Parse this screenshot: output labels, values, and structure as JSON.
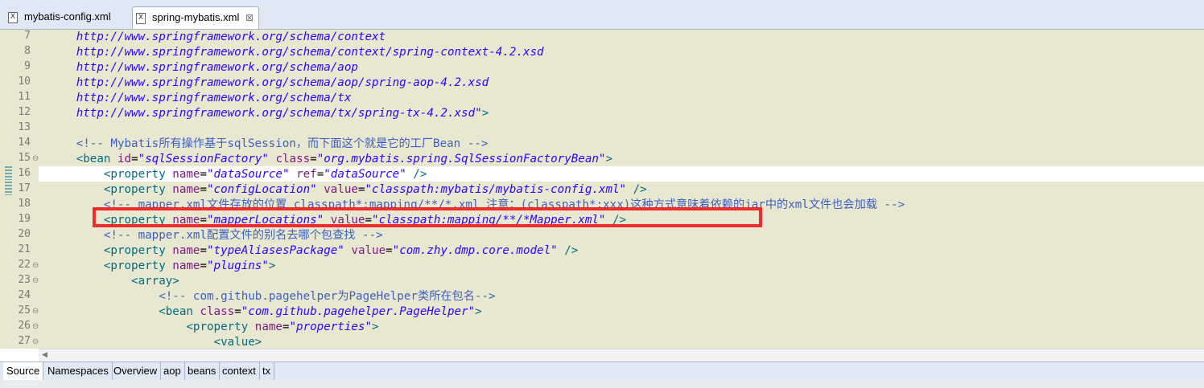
{
  "tabs": [
    {
      "label": "mybatis-config.xml",
      "icon": "xml-file-icon",
      "active": false
    },
    {
      "label": "spring-mybatis.xml",
      "icon": "xml-file-icon",
      "active": true,
      "close": "⊠"
    }
  ],
  "editor": {
    "line_numbers": [
      "7",
      "8",
      "9",
      "10",
      "11",
      "12",
      "13",
      "14",
      "15",
      "16",
      "17",
      "18",
      "19",
      "20",
      "21",
      "22",
      "23",
      "24",
      "25",
      "26",
      "27"
    ],
    "fold_marker": "⊖",
    "lines": {
      "l7": "http://www.springframework.org/schema/context",
      "l8": "http://www.springframework.org/schema/context/spring-context-4.2.xsd",
      "l9": "http://www.springframework.org/schema/aop",
      "l10": "http://www.springframework.org/schema/aop/spring-aop-4.2.xsd",
      "l11": "http://www.springframework.org/schema/tx",
      "l12_url": "http://www.springframework.org/schema/tx/spring-tx-4.2.xsd\"",
      "l12_end": ">",
      "l14_open": "<!-- Mybatis",
      "l14_cjk1": "所有操作基于",
      "l14_mid": "sqlSession",
      "l14_cjk2": "，而下面这个就是它的工厂",
      "l14_end": "Bean -->",
      "l15_tag": "<bean ",
      "l15_id": "id",
      "l15_eq1": "=",
      "l15_idv": "\"sqlSessionFactory\"",
      "l15_class": "class",
      "l15_eq2": "=",
      "l15_classv": "\"org.mybatis.spring.SqlSessionFactoryBean\"",
      "l15_end": ">",
      "l16_tag": "<property ",
      "l16_name": "name",
      "l16_eq1": "=",
      "l16_namev": "\"dataSource\"",
      "l16_ref": "ref",
      "l16_eq2": "=",
      "l16_refv": "\"dataSource\"",
      "l16_end": " />",
      "l17_tag": "<property ",
      "l17_name": "name",
      "l17_eq1": "=",
      "l17_namev": "\"configLocation\"",
      "l17_value": "value",
      "l17_eq2": "=",
      "l17_valuev": "\"classpath:mybatis/mybatis-config.xml\"",
      "l17_end": " />",
      "l18_open": "<!-- mapper.xml",
      "l18_cjk1": "文件存放的位置",
      "l18_mid": " classpath*:mapping/**/*.xml ",
      "l18_cjk2": "注意：",
      "l18_mid2": "(classpath*:xxx)",
      "l18_cjk3": "这种方式意味着依赖的",
      "l18_jar": "jar",
      "l18_cjk4": "中的",
      "l18_xml": "xml",
      "l18_cjk5": "文件也会加载",
      "l18_end": " -->",
      "l19_tag": "<property ",
      "l19_name": "name",
      "l19_eq1": "=",
      "l19_namev": "\"mapperLocations\"",
      "l19_value": "value",
      "l19_eq2": "=",
      "l19_valuev": "\"classpath:mapping/**/*Mapper.xml\"",
      "l19_end": " />",
      "l20_open": "<!-- mapper.xml",
      "l20_cjk": "配置文件的别名去哪个包查找",
      "l20_end": " -->",
      "l21_tag": "<property ",
      "l21_name": "name",
      "l21_eq1": "=",
      "l21_namev": "\"typeAliasesPackage\"",
      "l21_value": "value",
      "l21_eq2": "=",
      "l21_valuev": "\"com.zhy.dmp.core.model\"",
      "l21_end": " />",
      "l22_tag": "<property ",
      "l22_name": "name",
      "l22_eq1": "=",
      "l22_namev": "\"plugins\"",
      "l22_end": ">",
      "l23": "<array>",
      "l24_open": "<!-- com.github.pagehelper",
      "l24_cjk1": "为",
      "l24_mid": "PageHelper",
      "l24_cjk2": "类所在包名",
      "l24_end": "-->",
      "l25_tag": "<bean ",
      "l25_class": "class",
      "l25_eq": "=",
      "l25_classv": "\"com.github.pagehelper.PageHelper\"",
      "l25_end": ">",
      "l26_tag": "<property ",
      "l26_name": "name",
      "l26_eq": "=",
      "l26_namev": "\"properties\"",
      "l26_end": ">",
      "l27": "<value>"
    }
  },
  "bottom_tabs": [
    "Source",
    "Namespaces",
    "Overview",
    "aop",
    "beans",
    "context",
    "tx"
  ],
  "colors": {
    "tag": "#006c84",
    "attr": "#7d1a82",
    "value": "#2f00ff",
    "comment": "#3e5fbf",
    "highlight": "#ef2b2b",
    "editor_bg": "#e8e8d0"
  }
}
